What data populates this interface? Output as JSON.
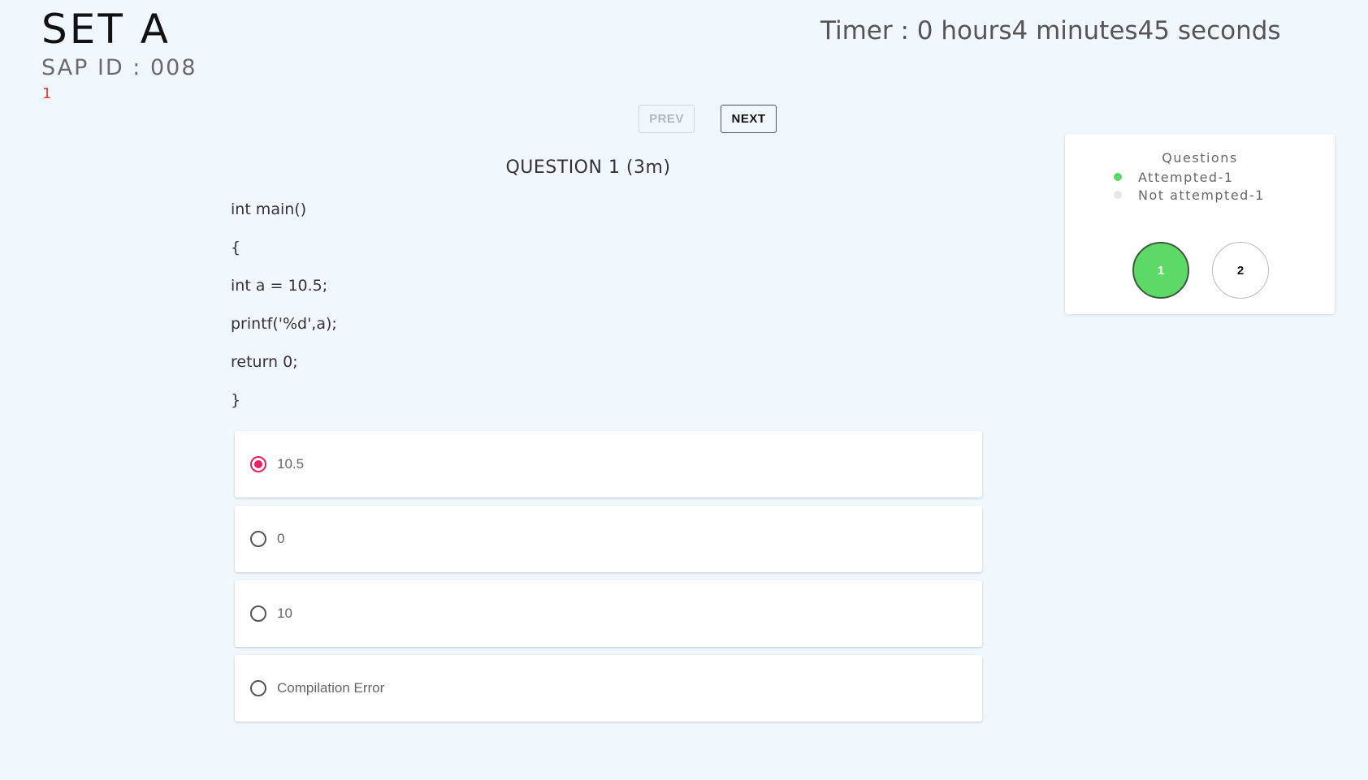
{
  "header": {
    "set_title": "SET A",
    "sap_id": "SAP ID : 008",
    "current_number": "1",
    "timer": "Timer : 0 hours4 minutes45 seconds"
  },
  "nav": {
    "prev_label": "PREV",
    "next_label": "NEXT"
  },
  "question": {
    "title": "QUESTION 1 (3m)",
    "code_lines": [
      "int main()",
      "{",
      "int a = 10.5;",
      "printf('%d',a);",
      "return 0;",
      "}"
    ],
    "options": [
      {
        "label": "10.5",
        "selected": true
      },
      {
        "label": "0",
        "selected": false
      },
      {
        "label": "10",
        "selected": false
      },
      {
        "label": "Compilation Error",
        "selected": false
      }
    ]
  },
  "panel": {
    "title": "Questions",
    "attempted_label": "Attempted-1",
    "not_attempted_label": "Not attempted-1",
    "questions": [
      {
        "number": "1",
        "status": "attempted"
      },
      {
        "number": "2",
        "status": "not-attempted"
      }
    ]
  },
  "colors": {
    "background": "#f1f8fd",
    "attempted_green": "#5cd966",
    "not_attempted_grey": "#e6e6e6",
    "radio_selected": "#e91e63",
    "current_number_red": "#e53935"
  }
}
